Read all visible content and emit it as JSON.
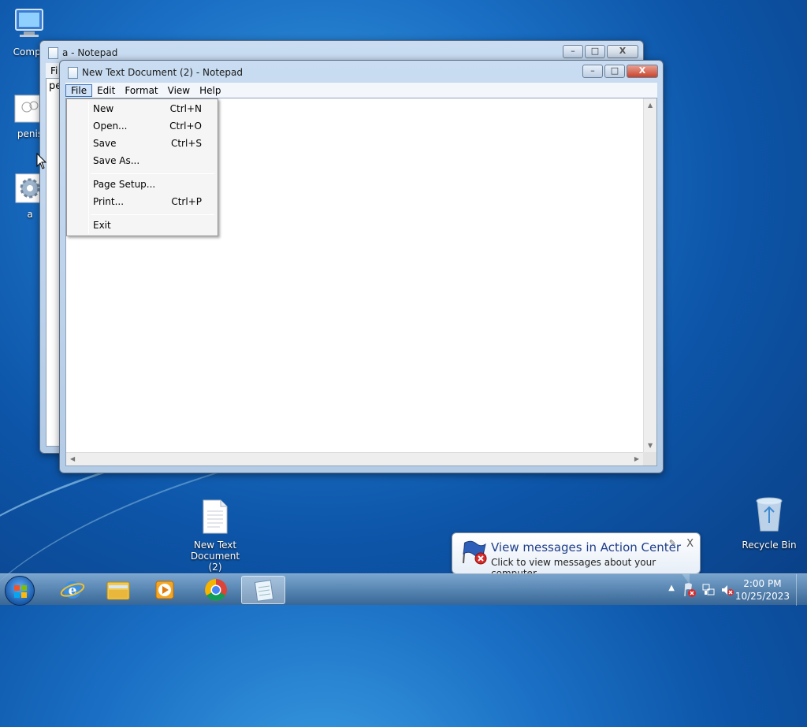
{
  "desktop": {
    "icons": [
      {
        "label": "Compu",
        "icon": "computer-icon"
      },
      {
        "label": "penis",
        "icon": "image-file-icon"
      },
      {
        "label": "a",
        "icon": "settings-file-icon"
      },
      {
        "label": "New Text Document (2)",
        "icon": "text-file-icon"
      },
      {
        "label": "Recycle Bin",
        "icon": "recycle-bin-icon"
      }
    ]
  },
  "back_window": {
    "title": "a - Notepad",
    "menu_partial": "Fi",
    "text_partial": "pe"
  },
  "front_window": {
    "title": "New Text Document (2) - Notepad",
    "menu": [
      "File",
      "Edit",
      "Format",
      "View",
      "Help"
    ],
    "active_menu": "File",
    "caption": {
      "minimize": "–",
      "maximize": "□",
      "close": "X"
    }
  },
  "file_menu": {
    "items": [
      {
        "label": "New",
        "shortcut": "Ctrl+N"
      },
      {
        "label": "Open...",
        "shortcut": "Ctrl+O"
      },
      {
        "label": "Save",
        "shortcut": "Ctrl+S"
      },
      {
        "label": "Save As...",
        "shortcut": ""
      },
      {
        "label": "Page Setup...",
        "shortcut": ""
      },
      {
        "label": "Print...",
        "shortcut": "Ctrl+P"
      },
      {
        "label": "Exit",
        "shortcut": ""
      }
    ]
  },
  "balloon": {
    "title": "View messages in Action Center",
    "text": "Click to view messages about your computer.",
    "close": "X"
  },
  "taskbar": {
    "time": "2:00 PM",
    "date": "10/25/2023",
    "tray_arrow": "▲",
    "apps": [
      "internet-explorer-icon",
      "file-explorer-icon",
      "media-player-icon",
      "chrome-icon",
      "notepad-icon"
    ]
  }
}
